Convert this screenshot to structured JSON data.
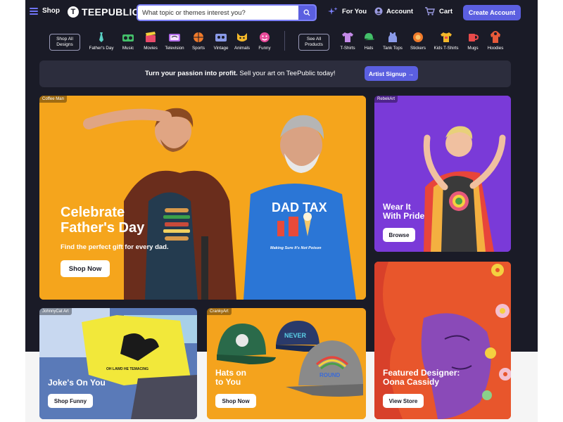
{
  "header": {
    "menu_label": "Shop",
    "logo_text": "TEEPUBLIC",
    "search_placeholder": "What topic or themes interest you?",
    "for_you_label": "For You",
    "account_label": "Account",
    "cart_label": "Cart",
    "create_account_label": "Create Account"
  },
  "categories": {
    "shop_all_designs": "Shop All Designs",
    "designs": [
      {
        "label": "Father's Day",
        "icon": "tie-icon",
        "color": "#5ad0c4"
      },
      {
        "label": "Music",
        "icon": "boombox-icon",
        "color": "#44c06a"
      },
      {
        "label": "Movies",
        "icon": "clapperboard-icon",
        "color": "#e84a6a"
      },
      {
        "label": "Television",
        "icon": "tv-icon",
        "color": "#b06ae8"
      },
      {
        "label": "Sports",
        "icon": "ball-icon",
        "color": "#f07a2a"
      },
      {
        "label": "Vintage",
        "icon": "cassette-icon",
        "color": "#8a9ae8"
      },
      {
        "label": "Animals",
        "icon": "cat-icon",
        "color": "#f4b82a"
      },
      {
        "label": "Funny",
        "icon": "smiley-icon",
        "color": "#e84a9a"
      }
    ],
    "see_all_products": "See All Products",
    "products": [
      {
        "label": "T-Shirts",
        "icon": "tshirt-icon",
        "color": "#c48ae8"
      },
      {
        "label": "Hats",
        "icon": "hat-icon",
        "color": "#44c06a"
      },
      {
        "label": "Tank Tops",
        "icon": "tank-top-icon",
        "color": "#8a9ae8"
      },
      {
        "label": "Stickers",
        "icon": "sticker-icon",
        "color": "#f07a2a"
      },
      {
        "label": "Kids T-Shirts",
        "icon": "kids-tshirt-icon",
        "color": "#f4b82a"
      },
      {
        "label": "Mugs",
        "icon": "mug-icon",
        "color": "#e84a4a"
      },
      {
        "label": "Hoodies",
        "icon": "hoodie-icon",
        "color": "#e85a3a"
      }
    ]
  },
  "promo": {
    "bold_text": "Turn your passion into profit.",
    "text": " Sell your art on TeePublic today!",
    "button_label": "Artist Signup →"
  },
  "tiles": {
    "hero": {
      "tag": "Coffee Man",
      "title_line1": "Celebrate",
      "title_line2": "Father's Day",
      "subtitle": "Find the perfect gift for every dad.",
      "button": "Shop Now",
      "shirt_text": "DAD TAX",
      "shirt_subtext": "Making Sure It's Not Poison"
    },
    "pride": {
      "tag": "RebekArt",
      "title_line1": "Wear It",
      "title_line2": "With Pride",
      "button": "Browse"
    },
    "jokes": {
      "tag": "JohnnyCat Art",
      "title": "Joke's On You",
      "button": "Shop Funny",
      "shirt_text": "OH LAWD HE TEMACING"
    },
    "hats": {
      "tag": "CrankyArt",
      "title_line1": "Hats on",
      "title_line2": "to You",
      "button": "Shop Now",
      "hat_text": "NEVER",
      "hat_text2": "ROUND"
    },
    "designer": {
      "title_line1": "Featured Designer:",
      "title_line2": "Oona Cassidy",
      "button": "View Store"
    }
  }
}
